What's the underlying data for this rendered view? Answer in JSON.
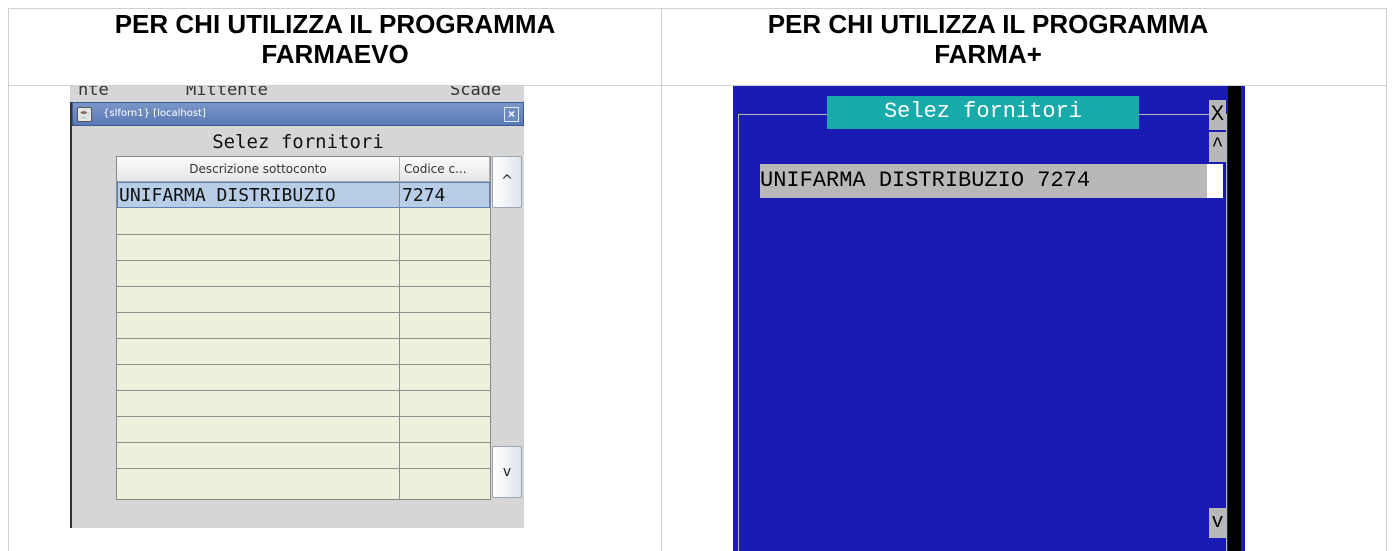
{
  "headers": {
    "left": [
      "PER CHI UTILIZZA IL PROGRAMMA",
      "FARMAEVO"
    ],
    "right": [
      "PER CHI UTILIZZA IL PROGRAMMA",
      "FARMA+"
    ]
  },
  "farmaevo": {
    "background_text": [
      "nte",
      "Mittente",
      "Scade"
    ],
    "window_title": "{slforn1} [localhost]",
    "close_symbol": "×",
    "heading": "Selez fornitori",
    "columns": [
      "Descrizione sottoconto",
      "Codice c..."
    ],
    "rows": [
      [
        "UNIFARMA DISTRIBUZIO",
        "7274"
      ]
    ],
    "scroll_up": "^",
    "scroll_down": "v"
  },
  "farmaplus": {
    "title": "Selez fornitori",
    "close_symbol": "X",
    "scroll_up": "^",
    "scroll_down": "v",
    "row": "UNIFARMA DISTRIBUZIO 7274",
    "colors": {
      "background": "#1a1ab4",
      "title_bg": "#18aaa8",
      "row_bg": "#b8b8b8"
    }
  }
}
